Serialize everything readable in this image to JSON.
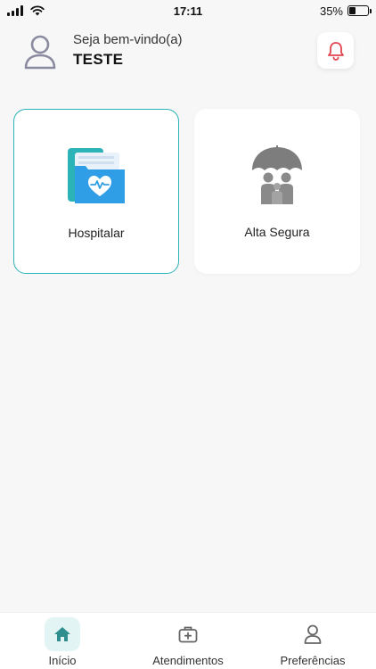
{
  "status_bar": {
    "time": "17:11",
    "battery": "35%",
    "battery_level": 0.35
  },
  "header": {
    "greeting": "Seja bem-vindo(a)",
    "username": "TESTE"
  },
  "cards": [
    {
      "label": "Hospitalar",
      "icon": "medical-folder-icon",
      "selected": true
    },
    {
      "label": "Alta Segura",
      "icon": "family-umbrella-icon",
      "selected": false
    }
  ],
  "bottom_nav": [
    {
      "label": "Início",
      "icon": "home-icon",
      "active": true
    },
    {
      "label": "Atendimentos",
      "icon": "medical-kit-icon",
      "active": false
    },
    {
      "label": "Preferências",
      "icon": "user-icon",
      "active": false
    }
  ],
  "colors": {
    "accent": "#2bb3b8",
    "bell": "#e0444f",
    "background": "#f7f7f7"
  }
}
